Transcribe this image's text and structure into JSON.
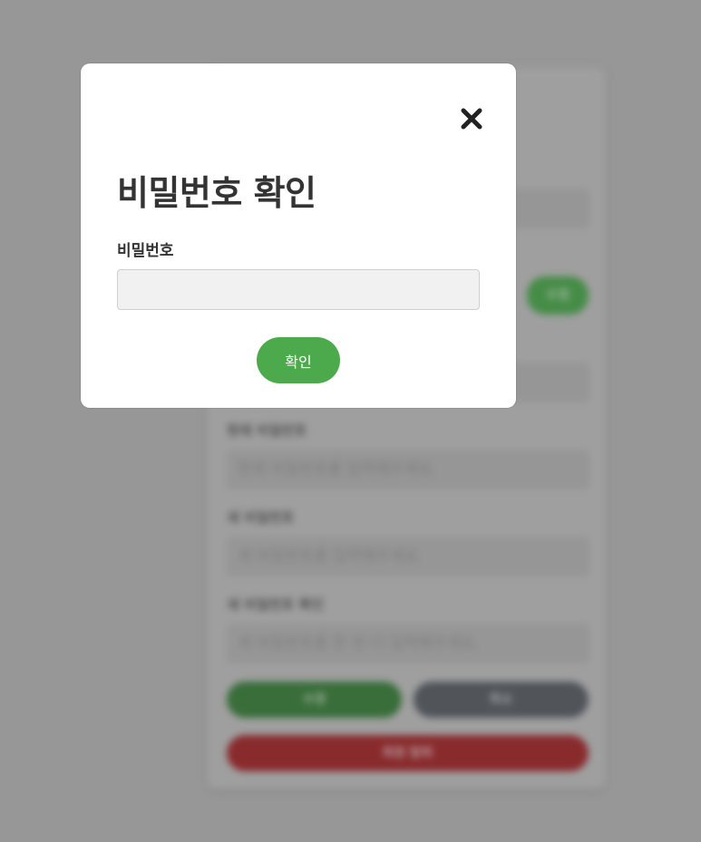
{
  "modal": {
    "title": "비밀번호 확인",
    "field_label": "비밀번호",
    "password_value": "",
    "confirm_label": "확인",
    "close_icon": "close-icon"
  },
  "background_form": {
    "current_password_label": "현재 비밀번호",
    "current_password_placeholder": "현재 비밀번호를 입력해주세요.",
    "new_password_label": "새 비밀번호",
    "new_password_placeholder": "새 비밀번호를 입력해주세요.",
    "confirm_password_label": "새 비밀번호 확인",
    "confirm_password_placeholder": "새 비밀번호를 한 번 더 입력해주세요.",
    "check_button": "수정",
    "save_button": "수정",
    "cancel_button": "취소",
    "withdraw_button": "회원 탈퇴"
  },
  "colors": {
    "primary_green": "#4caa4d",
    "cancel_gray": "#4a4f55",
    "danger_red": "#8a1f22"
  }
}
